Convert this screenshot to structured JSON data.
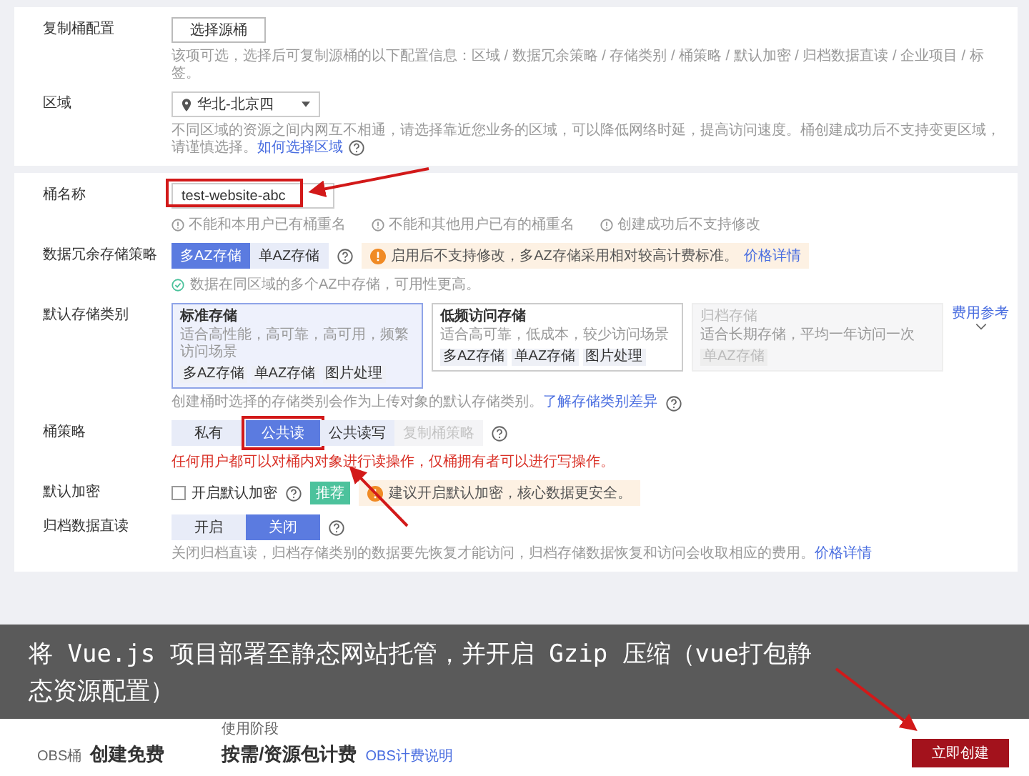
{
  "sections": [
    {
      "rows": [
        {
          "kind": "button",
          "label": "复制桶配置",
          "button": "选择源桶",
          "hint": "该项可选，选择后可复制源桶的以下配置信息：区域 / 数据冗余策略 / 存储类别 / 桶策略 / 默认加密 / 归档数据直读 / 企业项目 / 标签。"
        },
        {
          "kind": "select",
          "label": "区域",
          "value": "华北-北京四",
          "hint": "不同区域的资源之间内网互不相通，请选择靠近您业务的区域，可以降低网络时延，提高访问速度。桶创建成功后不支持变更区域，请谨慎选择。",
          "link": "如何选择区域"
        }
      ]
    },
    {
      "rows": [
        {
          "kind": "input",
          "label": "桶名称",
          "value": "test-website-abc",
          "annotated": true,
          "tips": [
            "不能和本用户已有桶重名",
            "不能和其他用户已有的桶重名",
            "创建成功后不支持修改"
          ]
        },
        {
          "kind": "segmented",
          "label": "数据冗余存储策略",
          "options": [
            {
              "label": "多AZ存储",
              "selected": true,
              "disabled": false,
              "annotated": false
            },
            {
              "label": "单AZ存储",
              "selected": false,
              "disabled": false,
              "annotated": false
            }
          ],
          "warning": {
            "text": "启用后不支持修改，多AZ存储采用相对较高计费标准。",
            "link": "价格详情"
          },
          "note": "数据在同区域的多个AZ中存储，可用性更高。"
        },
        {
          "kind": "cards",
          "label": "默认存储类别",
          "cards": [
            {
              "title": "标准存储",
              "desc": "适合高性能，高可靠，高可用，频繁访问场景",
              "tags": [
                "多AZ存储",
                "单AZ存储",
                "图片处理"
              ],
              "selected": true,
              "disabled": false
            },
            {
              "title": "低频访问存储",
              "desc": "适合高可靠，低成本，较少访问场景",
              "tags": [
                "多AZ存储",
                "单AZ存储",
                "图片处理"
              ],
              "selected": false,
              "disabled": false
            },
            {
              "title": "归档存储",
              "desc": "适合长期存储，平均一年访问一次",
              "tags": [
                "单AZ存储"
              ],
              "selected": false,
              "disabled": true
            }
          ],
          "side_link": "费用参考",
          "hint": "创建桶时选择的存储类别会作为上传对象的默认存储类别。",
          "link": "了解存储类别差异"
        },
        {
          "kind": "segmented",
          "label": "桶策略",
          "options": [
            {
              "label": "私有",
              "selected": false,
              "disabled": false,
              "annotated": false
            },
            {
              "label": "公共读",
              "selected": true,
              "disabled": false,
              "annotated": true
            },
            {
              "label": "公共读写",
              "selected": false,
              "disabled": false,
              "annotated": false
            },
            {
              "label": "复制桶策略",
              "selected": false,
              "disabled": true,
              "annotated": false
            }
          ],
          "error": "任何用户都可以对桶内对象进行读操作，仅桶拥有者可以进行写操作。"
        },
        {
          "kind": "checkbox",
          "label": "默认加密",
          "checkbox": {
            "label": "开启默认加密",
            "checked": false
          },
          "badge": "推荐",
          "warning": {
            "text": "建议开启默认加密，核心数据更安全。"
          }
        },
        {
          "kind": "segmented",
          "label": "归档数据直读",
          "options": [
            {
              "label": "开启",
              "selected": false,
              "disabled": false,
              "annotated": false
            },
            {
              "label": "关闭",
              "selected": true,
              "disabled": false,
              "annotated": false
            }
          ],
          "hint": "关闭归档直读，归档存储类别的数据要先恢复才能访问，归档存储数据恢复和访问会收取相应的费用。",
          "link": "价格详情"
        }
      ]
    }
  ],
  "caption": "将 Vue.js 项目部署至静态网站托管，并开启 Gzip 压缩（vue打包静态资源配置）",
  "footer": {
    "left": {
      "prefix": "OBS桶",
      "value": "创建免费"
    },
    "middle": {
      "caption": "使用阶段",
      "value": "按需/资源包计费",
      "link": "OBS计费说明"
    },
    "button": "立即创建"
  }
}
